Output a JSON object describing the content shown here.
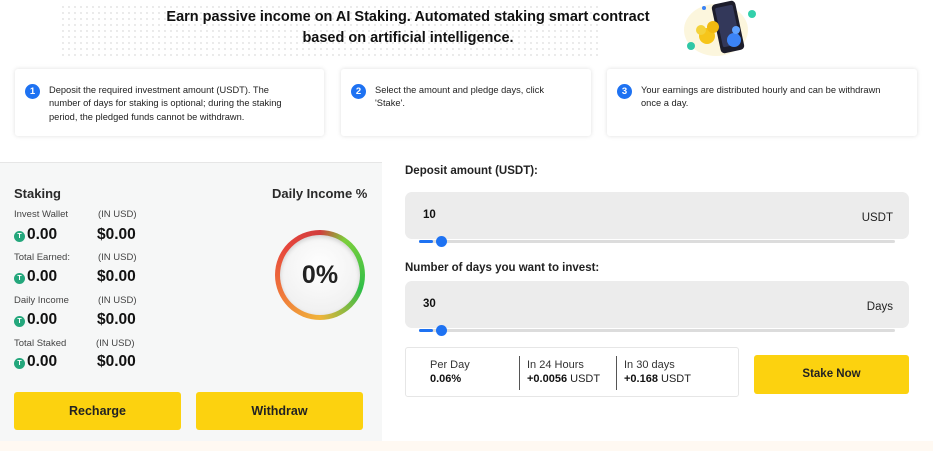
{
  "hero": {
    "line1": "Earn passive income on AI Staking. Automated staking smart contract",
    "line2": "based on artificial intelligence."
  },
  "steps": [
    {
      "num": "1",
      "lines": [
        "Deposit the required investment amount (USDT). The",
        "number of days for staking is optional; during the staking",
        "period, the pledged funds cannot be withdrawn."
      ]
    },
    {
      "num": "2",
      "lines": [
        "Select the amount and pledge days, click",
        "'Stake'."
      ]
    },
    {
      "num": "3",
      "lines": [
        "Your earnings are distributed hourly and can be withdrawn",
        "once a day."
      ]
    }
  ],
  "staking": {
    "title": "Staking",
    "daily_income_title": "Daily Income %",
    "rows": [
      {
        "label": "Invest Wallet",
        "unit": "(IN USD)",
        "amount": "0.00",
        "usd": "$0.00"
      },
      {
        "label": "Total Earned:",
        "unit": "(IN USD)",
        "amount": "0.00",
        "usd": "$0.00"
      },
      {
        "label": "Daily Income",
        "unit": "(IN USD)",
        "amount": "0.00",
        "usd": "$0.00"
      },
      {
        "label": "Total Staked",
        "unit": "(IN USD)",
        "amount": "0.00",
        "usd": "$0.00"
      }
    ],
    "percent": "0%",
    "token_icon": "T",
    "recharge_label": "Recharge",
    "withdraw_label": "Withdraw"
  },
  "deposit": {
    "label": "Deposit amount (USDT):",
    "value": "10",
    "unit": "USDT",
    "slider_fraction": 0.03
  },
  "days": {
    "label": "Number of days you want to invest:",
    "value": "30",
    "unit": "Days",
    "slider_fraction": 0.03
  },
  "summary": {
    "per_day_label": "Per Day",
    "per_day_value": "0.06%",
    "h24_label": "In 24 Hours",
    "h24_value": "+0.0056",
    "h24_unit": "USDT",
    "d30_label": "In 30 days",
    "d30_value": "+0.168",
    "d30_unit": "USDT"
  },
  "stake_button": "Stake Now",
  "colors": {
    "accent": "#fcd20f",
    "blue": "#1e72f2",
    "token": "#24a77c"
  }
}
